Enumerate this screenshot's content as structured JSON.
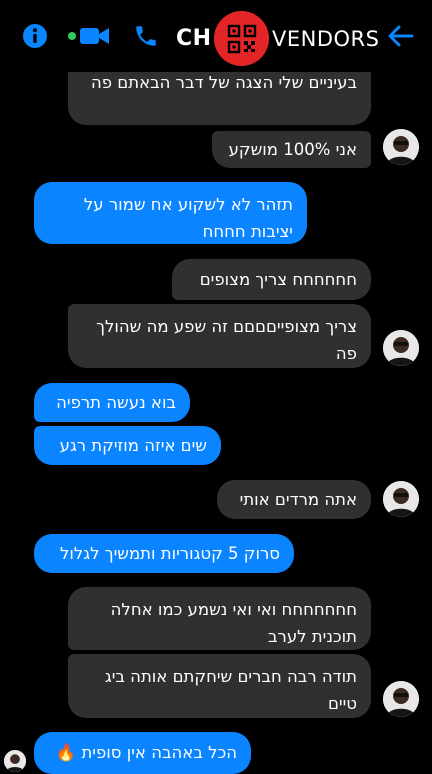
{
  "header": {
    "title_left": "CH",
    "title_right": "VENDORS",
    "icons": [
      "info-icon",
      "video-call-icon",
      "phone-icon",
      "back-arrow-icon"
    ],
    "colors": {
      "accent": "#0a84ff",
      "logo": "#e42528",
      "active_dot": "#31c95b"
    }
  },
  "messages": [
    {
      "from": "contact",
      "text": "בעיניים שלי הצגה של דבר הבאתם פה"
    },
    {
      "from": "contact",
      "text": "אני 100% מושקע"
    },
    {
      "from": "me",
      "text": "תזהר לא לשקוע אח שמור על יציבות חחחח"
    },
    {
      "from": "contact",
      "text": "חחחחחח צריך מצופים"
    },
    {
      "from": "contact",
      "text": "צריך מצופייםםםם זה שפע מה שהולך פה"
    },
    {
      "from": "me",
      "text": "בוא נעשה תרפיה"
    },
    {
      "from": "me",
      "text": "שים איזה מוזיקת רגע"
    },
    {
      "from": "contact",
      "text": "אתה מרדים אותי"
    },
    {
      "from": "me",
      "text": "סרוק 5 קטגוריות ותמשיך לגלול"
    },
    {
      "from": "contact",
      "text": "חחחחחחח ואי ואי נשמע כמו אחלה תוכנית לערב"
    },
    {
      "from": "contact",
      "text": "תודה רבה חברים שיחקתם אותה ביג טיים"
    },
    {
      "from": "me",
      "text": "הכל באהבה אין סופית 🔥"
    }
  ]
}
